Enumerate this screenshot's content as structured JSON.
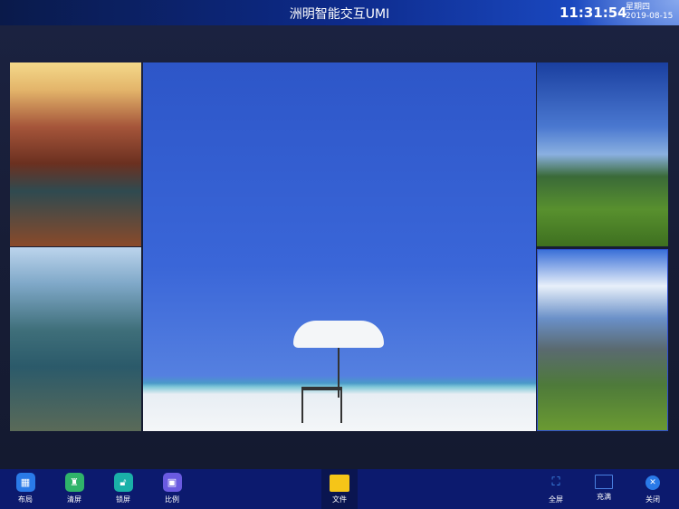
{
  "header": {
    "title": "洲明智能交互UMI",
    "time": "11:31:54",
    "weekday": "星期四",
    "date": "2019-08-15"
  },
  "toolbar": {
    "left": [
      {
        "label": "布局",
        "icon": "layout-icon",
        "color": "#2a7ae8"
      },
      {
        "label": "清屏",
        "icon": "broom-icon",
        "color": "#2fb36a"
      },
      {
        "label": "锁屏",
        "icon": "lock-icon",
        "color": "#1ab0a8"
      },
      {
        "label": "比例",
        "icon": "ratio-icon",
        "color": "#6a5ae0"
      }
    ],
    "center": {
      "label": "文件",
      "icon": "folder-icon",
      "color": "#f5c518"
    },
    "right": [
      {
        "label": "全屏",
        "icon": "fullscreen-icon"
      },
      {
        "label": "充满",
        "icon": "fill-icon"
      },
      {
        "label": "关闭",
        "icon": "close-icon",
        "color": "#2a7ae8"
      }
    ]
  }
}
